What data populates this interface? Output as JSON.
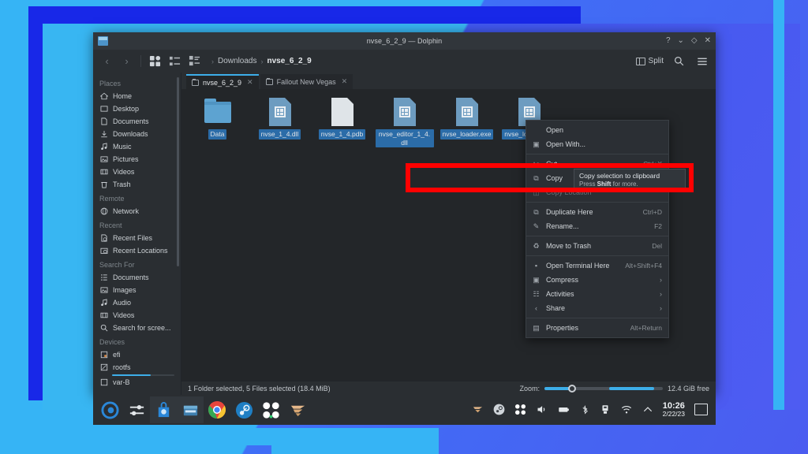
{
  "window": {
    "title": "nvse_6_2_9 — Dolphin",
    "app_icon": "folder-icon",
    "controls": {
      "help": "?",
      "minimize": "⌄",
      "maximize": "◇",
      "close": "✕"
    }
  },
  "toolbar": {
    "back": "‹",
    "forward": "›",
    "view_icons": "icons-view-icon",
    "view_compact": "compact-view-icon",
    "view_details": "details-view-icon",
    "breadcrumb": [
      {
        "label": "Downloads",
        "current": false
      },
      {
        "label": "nvse_6_2_9",
        "current": true
      }
    ],
    "split_label": "Split",
    "search_icon": "search-icon",
    "menu_icon": "hamburger-menu-icon"
  },
  "sidebar": {
    "sections": [
      {
        "title": "Places",
        "items": [
          {
            "label": "Home",
            "icon": "home-icon"
          },
          {
            "label": "Desktop",
            "icon": "desktop-icon"
          },
          {
            "label": "Documents",
            "icon": "document-icon"
          },
          {
            "label": "Downloads",
            "icon": "download-icon"
          },
          {
            "label": "Music",
            "icon": "music-note-icon"
          },
          {
            "label": "Pictures",
            "icon": "picture-icon"
          },
          {
            "label": "Videos",
            "icon": "video-icon"
          },
          {
            "label": "Trash",
            "icon": "trash-icon"
          }
        ]
      },
      {
        "title": "Remote",
        "items": [
          {
            "label": "Network",
            "icon": "network-icon"
          }
        ]
      },
      {
        "title": "Recent",
        "items": [
          {
            "label": "Recent Files",
            "icon": "recent-file-icon"
          },
          {
            "label": "Recent Locations",
            "icon": "recent-location-icon"
          }
        ]
      },
      {
        "title": "Search For",
        "items": [
          {
            "label": "Documents",
            "icon": "document-search-icon"
          },
          {
            "label": "Images",
            "icon": "image-search-icon"
          },
          {
            "label": "Audio",
            "icon": "audio-search-icon"
          },
          {
            "label": "Videos",
            "icon": "video-search-icon"
          },
          {
            "label": "Search for scree...",
            "icon": "search-icon"
          }
        ]
      },
      {
        "title": "Devices",
        "items": [
          {
            "label": "efi",
            "icon": "disk-icon"
          },
          {
            "label": "rootfs",
            "icon": "disk-icon",
            "capacity": 62
          },
          {
            "label": "var-B",
            "icon": "disk-icon"
          }
        ]
      }
    ]
  },
  "tabs": [
    {
      "label": "nvse_6_2_9",
      "active": true,
      "close": "✕",
      "icon": "folder-tab-icon"
    },
    {
      "label": "Fallout New Vegas",
      "active": false,
      "close": "✕",
      "icon": "folder-tab-icon"
    }
  ],
  "files": [
    {
      "name": "Data",
      "type": "folder",
      "selected": true
    },
    {
      "name": "nvse_1_4.dll",
      "type": "binary",
      "selected": true
    },
    {
      "name": "nvse_1_4.pdb",
      "type": "document",
      "selected": true
    },
    {
      "name": "nvse_editor_1_4.dll",
      "type": "binary",
      "selected": true
    },
    {
      "name": "nvse_loader.exe",
      "type": "binary",
      "selected": true
    },
    {
      "name": "nvse_loader.pdb",
      "type": "binary",
      "selected": true
    }
  ],
  "context_menu": {
    "items": [
      {
        "label": "Open",
        "icon": "",
        "accel": "",
        "kind": "item"
      },
      {
        "label": "Open With...",
        "icon": "open-with-icon",
        "accel": "",
        "kind": "item"
      },
      {
        "kind": "separator"
      },
      {
        "label": "Cut",
        "icon": "scissors-icon",
        "accel": "Ctrl+X",
        "kind": "item"
      },
      {
        "label": "Copy",
        "icon": "copy-icon",
        "accel": "",
        "kind": "item",
        "highlighted": true
      },
      {
        "label": "Copy Location",
        "icon": "copy-location-icon",
        "accel": "",
        "kind": "item",
        "disabled": true
      },
      {
        "kind": "separator"
      },
      {
        "label": "Duplicate Here",
        "icon": "duplicate-icon",
        "accel": "Ctrl+D",
        "kind": "item"
      },
      {
        "label": "Rename...",
        "icon": "pencil-icon",
        "accel": "F2",
        "kind": "item"
      },
      {
        "kind": "separator"
      },
      {
        "label": "Move to Trash",
        "icon": "trash-icon",
        "accel": "Del",
        "kind": "item"
      },
      {
        "kind": "separator"
      },
      {
        "label": "Open Terminal Here",
        "icon": "terminal-icon",
        "accel": "Alt+Shift+F4",
        "kind": "item"
      },
      {
        "label": "Compress",
        "icon": "compress-icon",
        "accel": "",
        "submenu": "›",
        "kind": "item"
      },
      {
        "label": "Activities",
        "icon": "activities-icon",
        "accel": "",
        "submenu": "›",
        "kind": "item"
      },
      {
        "label": "Share",
        "icon": "share-icon",
        "accel": "",
        "submenu": "›",
        "kind": "item"
      },
      {
        "kind": "separator"
      },
      {
        "label": "Properties",
        "icon": "properties-icon",
        "accel": "Alt+Return",
        "kind": "item"
      }
    ]
  },
  "tooltip": {
    "title": "Copy selection to clipboard",
    "hint_prefix": "Press ",
    "hint_key": "Shift",
    "hint_suffix": " for more."
  },
  "statusbar": {
    "selection": "1 Folder selected, 5 Files selected (18.4 MiB)",
    "zoom_label": "Zoom:",
    "free_space": "12.4 GiB free"
  },
  "taskbar": {
    "launchers": [
      {
        "name": "application-launcher-icon"
      },
      {
        "name": "settings-icon"
      },
      {
        "name": "discover-icon"
      },
      {
        "name": "dolphin-icon"
      },
      {
        "name": "chrome-icon"
      },
      {
        "name": "steam-icon"
      },
      {
        "name": "lutris-icon"
      },
      {
        "name": "twister-icon"
      }
    ],
    "tray": [
      {
        "name": "twister-tray-icon"
      },
      {
        "name": "steam-tray-icon"
      },
      {
        "name": "lutris-tray-icon"
      },
      {
        "name": "volume-icon"
      },
      {
        "name": "battery-icon"
      },
      {
        "name": "bluetooth-icon"
      },
      {
        "name": "usb-icon"
      },
      {
        "name": "wifi-icon"
      },
      {
        "name": "expand-tray-icon"
      }
    ],
    "clock": {
      "time": "10:26",
      "date": "2/22/23"
    },
    "show_desktop": "show-desktop-icon"
  },
  "colors": {
    "accent": "#3daee9",
    "selection": "#2b6ca8",
    "annotation": "#ff0000",
    "window_bg": "#232629",
    "panel_bg": "#2a2e32"
  }
}
